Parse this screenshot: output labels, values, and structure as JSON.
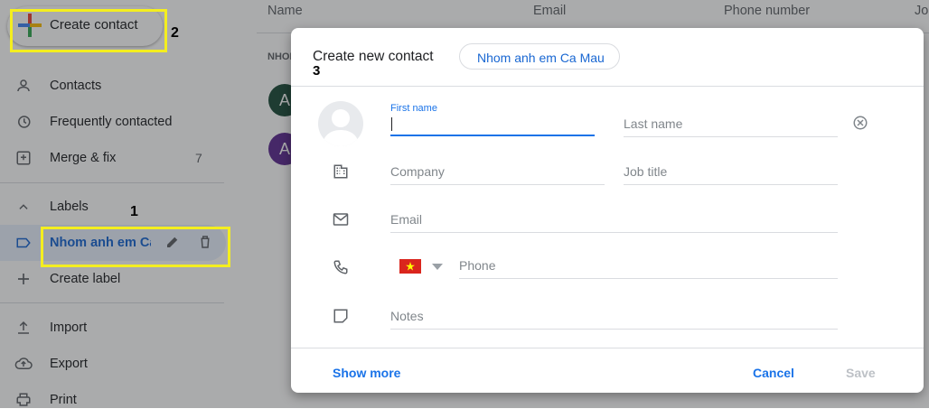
{
  "sidebar": {
    "create_contact": "Create contact",
    "items": [
      {
        "label": "Contacts",
        "icon": "person-icon"
      },
      {
        "label": "Frequently contacted",
        "icon": "history-icon"
      },
      {
        "label": "Merge & fix",
        "icon": "merge-icon",
        "count": "7"
      }
    ],
    "labels_header": "Labels",
    "active_label": "Nhom anh em Ca",
    "create_label": "Create label",
    "bottom": [
      {
        "label": "Import",
        "icon": "upload-icon"
      },
      {
        "label": "Export",
        "icon": "cloud-upload-icon"
      },
      {
        "label": "Print",
        "icon": "print-icon"
      }
    ]
  },
  "list": {
    "columns": [
      "Name",
      "Email",
      "Phone number",
      "Jo"
    ],
    "group_header": "NHOM",
    "avatars": [
      {
        "letter": "A",
        "color": "#1e4d3a"
      },
      {
        "letter": "A",
        "color": "#5e2d91"
      }
    ]
  },
  "annotations": {
    "one": "1",
    "two": "2",
    "three": "3"
  },
  "dialog": {
    "title": "Create new contact",
    "label_chip": "Nhom anh em Ca Mau",
    "first_name_label": "First name",
    "first_name_value": "",
    "last_name_placeholder": "Last name",
    "company_placeholder": "Company",
    "job_title_placeholder": "Job title",
    "email_placeholder": "Email",
    "phone_placeholder": "Phone",
    "notes_placeholder": "Notes",
    "show_more": "Show more",
    "cancel": "Cancel",
    "save": "Save"
  },
  "colors": {
    "accent": "#1a73e8",
    "highlight": "#f4ee1f",
    "flag_red": "#da251d",
    "flag_star": "#ffff00"
  }
}
